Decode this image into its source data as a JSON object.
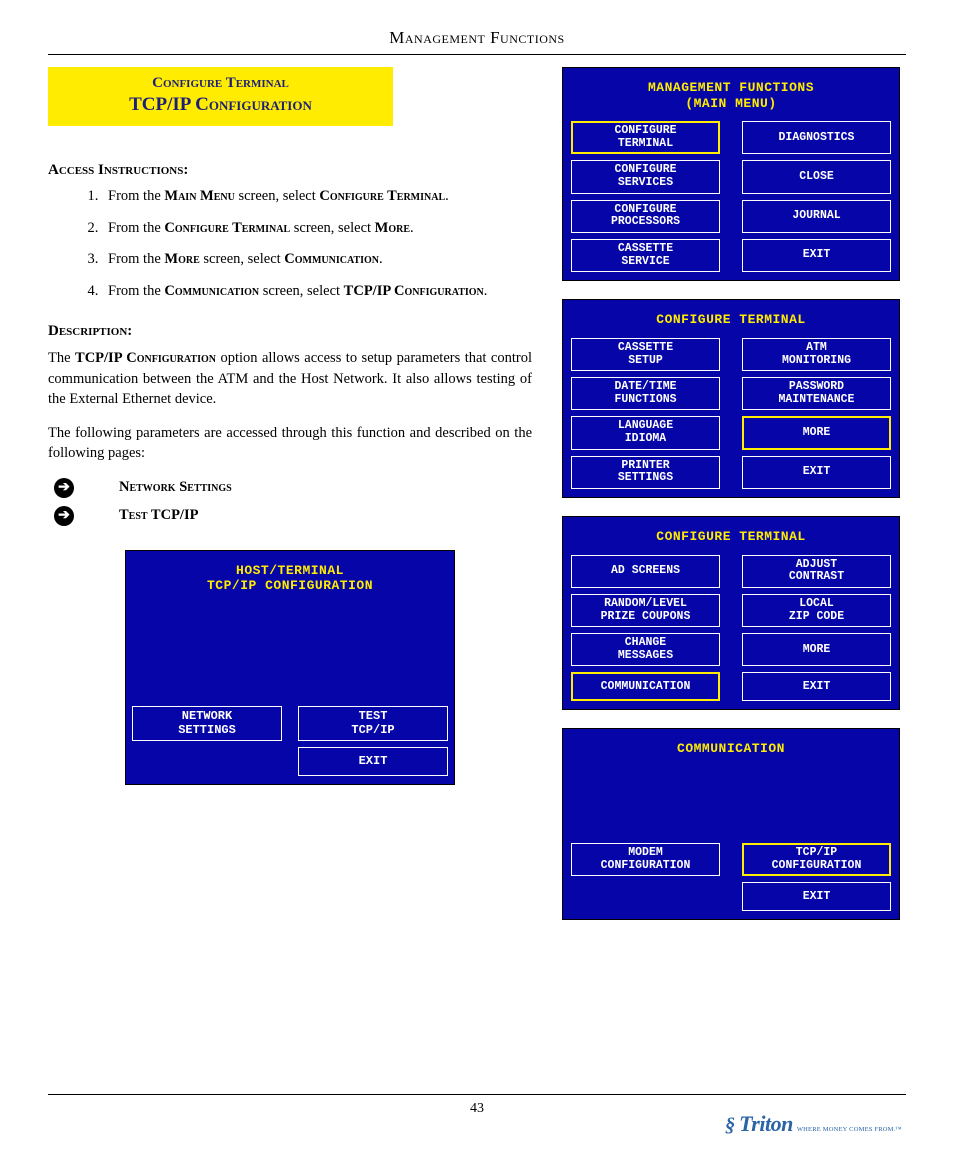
{
  "header": {
    "title": "Management Functions"
  },
  "yellow_box": {
    "line1": "Configure Terminal",
    "line2": "TCP/IP Configuration"
  },
  "labels": {
    "access": "Access Instructions:",
    "description": "Description:"
  },
  "steps": [
    {
      "prefix": "From the ",
      "b1": "Main Menu",
      "mid": " screen, select ",
      "b2": "Configure Terminal",
      "suffix": "."
    },
    {
      "prefix": "From the ",
      "b1": "Configure Terminal",
      "mid": "  screen, select ",
      "b2": "More",
      "suffix": "."
    },
    {
      "prefix": "From the ",
      "b1": "More",
      "mid": " screen, select ",
      "b2": "Communication",
      "suffix": "."
    },
    {
      "prefix": "From the ",
      "b1": "Communication",
      "mid": " screen, select ",
      "b2": "TCP/IP Configuration",
      "suffix": "."
    }
  ],
  "description_p1_a": "The ",
  "description_p1_b": "TCP/IP Configuration",
  "description_p1_c": " option allows access to setup parameters that control communication between the ATM and the Host Network. It also allows testing of the External Ethernet device.",
  "description_p2": "The following parameters are accessed through this function and described on the following pages:",
  "bullets": [
    {
      "label": "Network Settings"
    },
    {
      "label": "Test TCP/IP"
    }
  ],
  "big_screen": {
    "title": "HOST/TERMINAL\nTCP/IP CONFIGURATION",
    "buttons": [
      {
        "label": "NETWORK\nSETTINGS",
        "sel": false
      },
      {
        "label": "TEST\nTCP/IP",
        "sel": false
      },
      {
        "label": "",
        "empty": true
      },
      {
        "label": "EXIT",
        "sel": false
      }
    ]
  },
  "screens": [
    {
      "title": "MANAGEMENT FUNCTIONS\n(MAIN MENU)",
      "buttons": [
        {
          "label": "CONFIGURE\nTERMINAL",
          "sel": true
        },
        {
          "label": "DIAGNOSTICS"
        },
        {
          "label": "CONFIGURE\nSERVICES"
        },
        {
          "label": "CLOSE"
        },
        {
          "label": "CONFIGURE\nPROCESSORS"
        },
        {
          "label": "JOURNAL"
        },
        {
          "label": "CASSETTE\nSERVICE"
        },
        {
          "label": "EXIT"
        }
      ]
    },
    {
      "title": "CONFIGURE TERMINAL",
      "buttons": [
        {
          "label": "CASSETTE\nSETUP"
        },
        {
          "label": "ATM\nMONITORING"
        },
        {
          "label": "DATE/TIME\nFUNCTIONS"
        },
        {
          "label": "PASSWORD\nMAINTENANCE"
        },
        {
          "label": "LANGUAGE\nIDIOMA"
        },
        {
          "label": "MORE",
          "sel": true
        },
        {
          "label": "PRINTER\nSETTINGS"
        },
        {
          "label": "EXIT"
        }
      ]
    },
    {
      "title": "CONFIGURE TERMINAL",
      "buttons": [
        {
          "label": "AD SCREENS"
        },
        {
          "label": "ADJUST\nCONTRAST"
        },
        {
          "label": "RANDOM/LEVEL\nPRIZE COUPONS"
        },
        {
          "label": "LOCAL\nZIP CODE"
        },
        {
          "label": "CHANGE\nMESSAGES"
        },
        {
          "label": "MORE"
        },
        {
          "label": "COMMUNICATION",
          "sel": true
        },
        {
          "label": "EXIT"
        }
      ]
    },
    {
      "title": "COMMUNICATION",
      "pad": true,
      "buttons": [
        {
          "label": "MODEM\nCONFIGURATION"
        },
        {
          "label": "TCP/IP\nCONFIGURATION",
          "sel": true
        },
        {
          "label": "",
          "empty": true
        },
        {
          "label": "EXIT"
        }
      ]
    }
  ],
  "footer": {
    "page": "43",
    "brand_name": "Triton",
    "brand_tag": "WHERE MONEY COMES FROM.™"
  }
}
